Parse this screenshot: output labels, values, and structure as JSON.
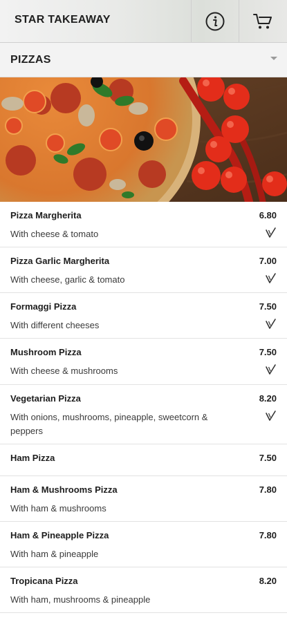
{
  "header": {
    "title": "STAR TAKEAWAY",
    "info_icon": "info-circle-icon",
    "cart_icon": "cart-icon"
  },
  "category": {
    "label": "PIZZAS",
    "icon": "chevron-down-icon"
  },
  "menu": {
    "items": [
      {
        "name": "Pizza Margherita",
        "price": "6.80",
        "desc": "With cheese & tomato",
        "veg": true
      },
      {
        "name": "Pizza Garlic Margherita",
        "price": "7.00",
        "desc": "With cheese, garlic & tomato",
        "veg": true
      },
      {
        "name": "Formaggi Pizza",
        "price": "7.50",
        "desc": "With different cheeses",
        "veg": true
      },
      {
        "name": "Mushroom Pizza",
        "price": "7.50",
        "desc": "With cheese & mushrooms",
        "veg": true
      },
      {
        "name": "Vegetarian Pizza",
        "price": "8.20",
        "desc": "With onions, mushrooms, pineapple, sweetcorn & peppers",
        "veg": true
      },
      {
        "name": "Ham Pizza",
        "price": "7.50",
        "desc": "",
        "veg": false
      },
      {
        "name": "Ham & Mushrooms Pizza",
        "price": "7.80",
        "desc": "With ham & mushrooms",
        "veg": false
      },
      {
        "name": "Ham & Pineapple Pizza",
        "price": "7.80",
        "desc": "With ham & pineapple",
        "veg": false
      },
      {
        "name": "Tropicana Pizza",
        "price": "8.20",
        "desc": "With ham, mushrooms & pineapple",
        "veg": false
      }
    ]
  },
  "colors": {
    "text": "#1d1d1d",
    "divider": "#e2e2e2",
    "category_bg": "#f3f3f3"
  }
}
